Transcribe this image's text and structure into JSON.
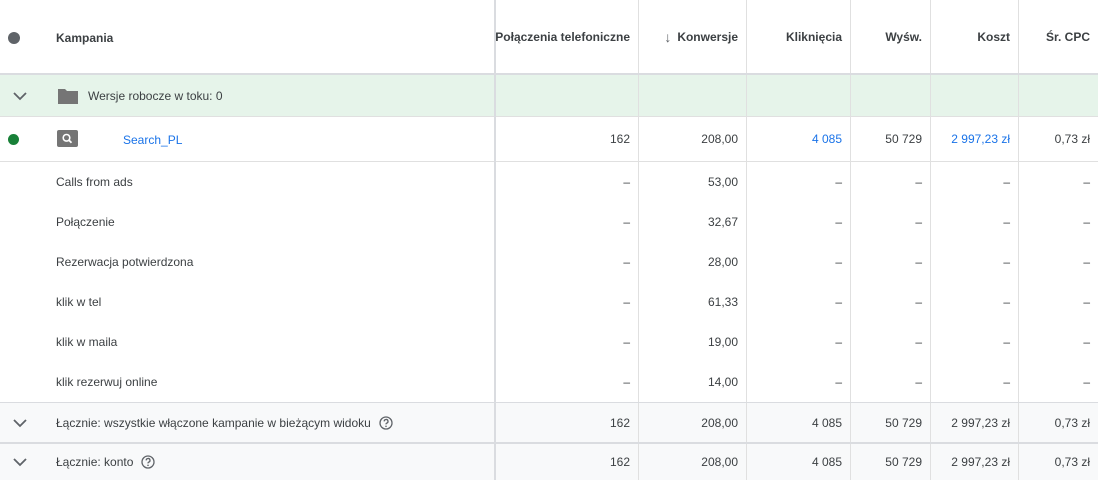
{
  "header": {
    "campaign": "Kampania",
    "calls": "Połączenia telefoniczne",
    "sort_arrow": "↓",
    "conversions": "Konwersje",
    "clicks": "Kliknięcia",
    "impressions": "Wyśw.",
    "cost": "Koszt",
    "avg_cpc": "Śr. CPC"
  },
  "drafts": {
    "label": "Wersje robocze w toku: 0",
    "icon": "folder-icon"
  },
  "campaign": {
    "name": "Search_PL",
    "status_color": "#188038",
    "calls": "162",
    "conversions": "208,00",
    "clicks": "4 085",
    "impressions": "50 729",
    "cost": "2 997,23 zł",
    "avg_cpc": "0,73 zł"
  },
  "conversion_actions": [
    {
      "name": "Calls from ads",
      "calls": "–",
      "conversions": "53,00",
      "clicks": "–",
      "impressions": "–",
      "cost": "–",
      "avg_cpc": "–"
    },
    {
      "name": "Połączenie",
      "calls": "–",
      "conversions": "32,67",
      "clicks": "–",
      "impressions": "–",
      "cost": "–",
      "avg_cpc": "–"
    },
    {
      "name": "Rezerwacja potwierdzona",
      "calls": "–",
      "conversions": "28,00",
      "clicks": "–",
      "impressions": "–",
      "cost": "–",
      "avg_cpc": "–"
    },
    {
      "name": "klik w tel",
      "calls": "–",
      "conversions": "61,33",
      "clicks": "–",
      "impressions": "–",
      "cost": "–",
      "avg_cpc": "–"
    },
    {
      "name": "klik w maila",
      "calls": "–",
      "conversions": "19,00",
      "clicks": "–",
      "impressions": "–",
      "cost": "–",
      "avg_cpc": "–"
    },
    {
      "name": "klik rezerwuj online",
      "calls": "–",
      "conversions": "14,00",
      "clicks": "–",
      "impressions": "–",
      "cost": "–",
      "avg_cpc": "–"
    }
  ],
  "totals": [
    {
      "label": "Łącznie: wszystkie włączone kampanie w bieżącym widoku",
      "calls": "162",
      "conversions": "208,00",
      "clicks": "4 085",
      "impressions": "50 729",
      "cost": "2 997,23 zł",
      "avg_cpc": "0,73 zł"
    },
    {
      "label": "Łącznie: konto",
      "calls": "162",
      "conversions": "208,00",
      "clicks": "4 085",
      "impressions": "50 729",
      "cost": "2 997,23 zł",
      "avg_cpc": "0,73 zł"
    }
  ]
}
